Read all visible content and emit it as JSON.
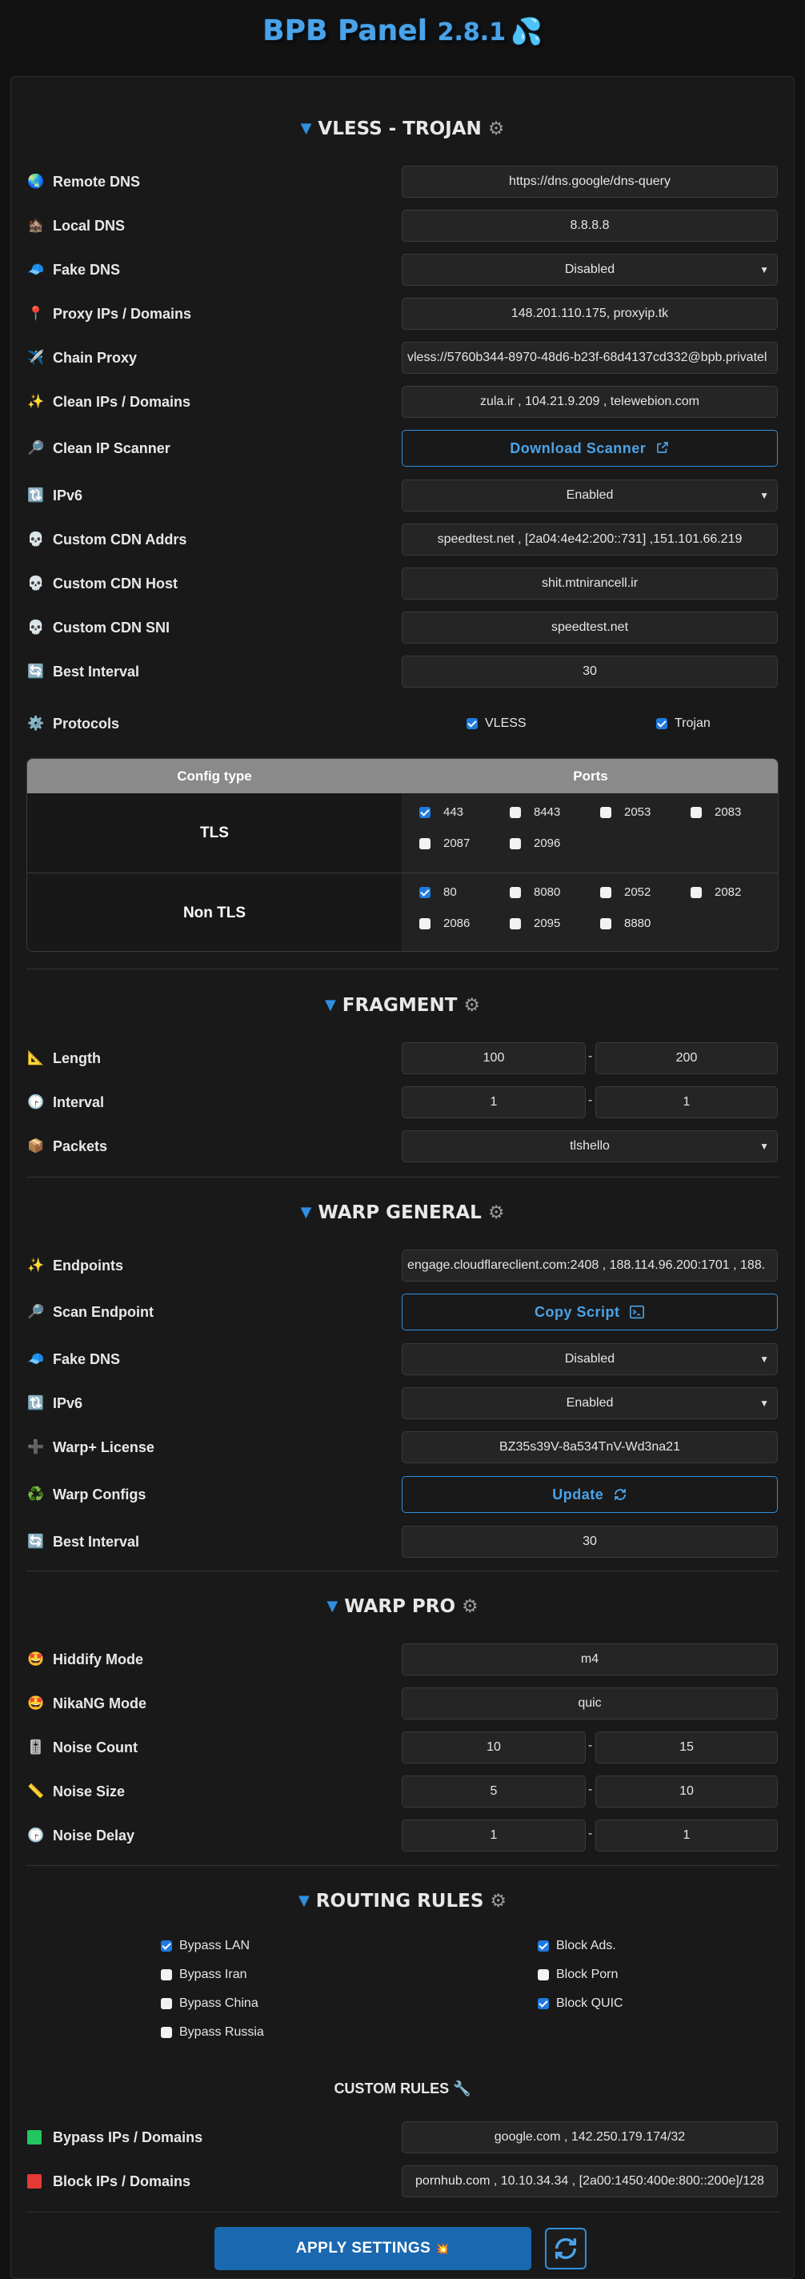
{
  "app": {
    "title": "BPB Panel",
    "version": "2.8.1",
    "drop_icon": "💦"
  },
  "vless": {
    "header": "VLESS - TROJAN",
    "remote_dns": {
      "label": "Remote DNS",
      "icon": "🌏",
      "value": "https://dns.google/dns-query"
    },
    "local_dns": {
      "label": "Local DNS",
      "icon": "🏚️",
      "value": "8.8.8.8"
    },
    "fake_dns": {
      "label": "Fake DNS",
      "icon": "🧢",
      "value": "Disabled"
    },
    "proxy_ips": {
      "label": "Proxy IPs / Domains",
      "icon": "📍",
      "value": "148.201.110.175, proxyip.tk"
    },
    "chain_proxy": {
      "label": "Chain Proxy",
      "icon": "✈️",
      "value": "vless://5760b344-8970-48d6-b23f-68d4137cd332@bpb.privatel"
    },
    "clean_ips": {
      "label": "Clean IPs / Domains",
      "icon": "✨",
      "value": "zula.ir , 104.21.9.209 , telewebion.com"
    },
    "clean_ip_scanner": {
      "label": "Clean IP Scanner",
      "icon": "🔎",
      "button": "Download Scanner"
    },
    "ipv6": {
      "label": "IPv6",
      "icon": "🔃",
      "value": "Enabled"
    },
    "cdn_addrs": {
      "label": "Custom CDN Addrs",
      "icon": "💀",
      "value": "speedtest.net , [2a04:4e42:200::731] ,151.101.66.219"
    },
    "cdn_host": {
      "label": "Custom CDN Host",
      "icon": "💀",
      "value": "shit.mtnirancell.ir"
    },
    "cdn_sni": {
      "label": "Custom CDN SNI",
      "icon": "💀",
      "value": "speedtest.net"
    },
    "best_interval": {
      "label": "Best Interval",
      "icon": "🔄",
      "value": "30"
    },
    "protocols": {
      "label": "Protocols",
      "icon": "⚙️",
      "vless": "VLESS",
      "trojan": "Trojan"
    }
  },
  "ports_table": {
    "col_config": "Config type",
    "col_ports": "Ports",
    "tls": {
      "label": "TLS",
      "ports": [
        {
          "p": "443",
          "on": true
        },
        {
          "p": "8443",
          "on": false
        },
        {
          "p": "2053",
          "on": false
        },
        {
          "p": "2083",
          "on": false
        },
        {
          "p": "2087",
          "on": false
        },
        {
          "p": "2096",
          "on": false
        }
      ]
    },
    "nontls": {
      "label": "Non TLS",
      "ports": [
        {
          "p": "80",
          "on": true
        },
        {
          "p": "8080",
          "on": false
        },
        {
          "p": "2052",
          "on": false
        },
        {
          "p": "2082",
          "on": false
        },
        {
          "p": "2086",
          "on": false
        },
        {
          "p": "2095",
          "on": false
        },
        {
          "p": "8880",
          "on": false
        }
      ]
    }
  },
  "fragment": {
    "header": "FRAGMENT",
    "length": {
      "label": "Length",
      "icon": "📐",
      "min": "100",
      "max": "200"
    },
    "interval": {
      "label": "Interval",
      "icon": "🕞",
      "min": "1",
      "max": "1"
    },
    "packets": {
      "label": "Packets",
      "icon": "📦",
      "value": "tlshello"
    }
  },
  "warp": {
    "header": "WARP GENERAL",
    "endpoints": {
      "label": "Endpoints",
      "icon": "✨",
      "value": "engage.cloudflareclient.com:2408 , 188.114.96.200:1701 , 188."
    },
    "scan_endpoint": {
      "label": "Scan Endpoint",
      "icon": "🔎",
      "button": "Copy Script"
    },
    "fake_dns": {
      "label": "Fake DNS",
      "icon": "🧢",
      "value": "Disabled"
    },
    "ipv6": {
      "label": "IPv6",
      "icon": "🔃",
      "value": "Enabled"
    },
    "license": {
      "label": "Warp+ License",
      "icon": "➕",
      "value": "BZ35s39V-8a534TnV-Wd3na21"
    },
    "configs": {
      "label": "Warp Configs",
      "icon": "♻️",
      "button": "Update"
    },
    "best_interval": {
      "label": "Best Interval",
      "icon": "🔄",
      "value": "30"
    }
  },
  "warp_pro": {
    "header": "WARP PRO",
    "hiddify": {
      "label": "Hiddify Mode",
      "icon": "🤩",
      "value": "m4"
    },
    "nikang": {
      "label": "NikaNG Mode",
      "icon": "🤩",
      "value": "quic"
    },
    "noise_count": {
      "label": "Noise Count",
      "icon": "🎚️",
      "min": "10",
      "max": "15"
    },
    "noise_size": {
      "label": "Noise Size",
      "icon": "📏",
      "min": "5",
      "max": "10"
    },
    "noise_delay": {
      "label": "Noise Delay",
      "icon": "🕞",
      "min": "1",
      "max": "1"
    }
  },
  "routing": {
    "header": "ROUTING RULES",
    "bypass_lan": "Bypass LAN",
    "bypass_iran": "Bypass Iran",
    "bypass_china": "Bypass China",
    "bypass_russia": "Bypass Russia",
    "block_ads": "Block Ads.",
    "block_porn": "Block Porn",
    "block_quic": "Block QUIC",
    "custom_header": "CUSTOM RULES",
    "bypass_ips": {
      "label": "Bypass IPs / Domains",
      "color": "#22c55e",
      "value": "google.com , 142.250.179.174/32"
    },
    "block_ips": {
      "label": "Block IPs / Domains",
      "color": "#e53935",
      "value": "pornhub.com , 10.10.34.34 , [2a00:1450:400e:800::200e]/128"
    }
  },
  "footer": {
    "apply": "APPLY SETTINGS",
    "apply_icon": "💥"
  },
  "icons": {
    "gear": "gear-icon",
    "triangle": "triangle-down-icon",
    "external": "external-link-icon",
    "terminal": "terminal-icon",
    "sync": "sync-icon",
    "wrench": "wrench-icon",
    "refresh": "refresh-icon"
  }
}
